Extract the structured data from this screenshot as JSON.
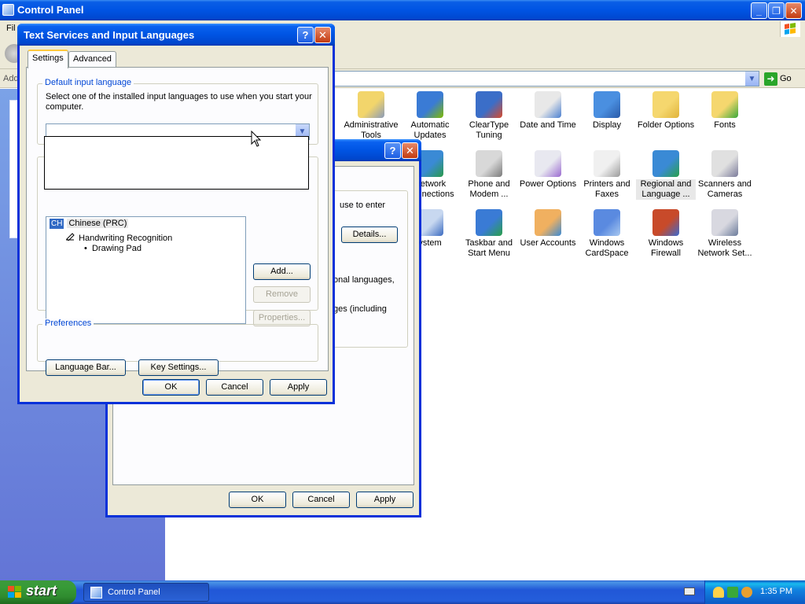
{
  "cp_window": {
    "title": "Control Panel",
    "menu_fragment": "Fil",
    "address_label_fragment": "Add",
    "go_label": "Go"
  },
  "cp_icons": [
    {
      "name": "administrative-tools",
      "label": "Administrative Tools",
      "icon": "folder-gear-icon"
    },
    {
      "name": "automatic-updates",
      "label": "Automatic Updates",
      "icon": "windows-globe-icon"
    },
    {
      "name": "cleartype-tuning",
      "label": "ClearType Tuning",
      "icon": "cleartype-icon"
    },
    {
      "name": "date-and-time",
      "label": "Date and Time",
      "icon": "clock-calendar-icon"
    },
    {
      "name": "display",
      "label": "Display",
      "icon": "monitor-icon"
    },
    {
      "name": "folder-options",
      "label": "Folder Options",
      "icon": "folder-icon"
    },
    {
      "name": "fonts",
      "label": "Fonts",
      "icon": "fonts-folder-icon"
    },
    {
      "name": "network-connections",
      "label": "Network Connections",
      "label_visible": "etwork\nnnections",
      "icon": "globe-network-icon"
    },
    {
      "name": "phone-and-modem",
      "label": "Phone and Modem ...",
      "icon": "phone-icon"
    },
    {
      "name": "power-options",
      "label": "Power Options",
      "icon": "power-icon"
    },
    {
      "name": "printers-and-faxes",
      "label": "Printers and Faxes",
      "icon": "printer-icon"
    },
    {
      "name": "regional-and-language",
      "label": "Regional and Language ...",
      "icon": "globe-icon"
    },
    {
      "name": "scanners-and-cameras",
      "label": "Scanners and Cameras",
      "icon": "scanner-camera-icon"
    },
    {
      "name": "system",
      "label": "ystem",
      "icon": "system-icon"
    },
    {
      "name": "taskbar-and-start-menu",
      "label": "Taskbar and Start Menu",
      "icon": "taskbar-icon"
    },
    {
      "name": "user-accounts",
      "label": "User Accounts",
      "icon": "users-icon"
    },
    {
      "name": "windows-cardspace",
      "label": "Windows CardSpace",
      "icon": "cardspace-icon"
    },
    {
      "name": "windows-firewall",
      "label": "Windows Firewall",
      "icon": "firewall-icon"
    },
    {
      "name": "wireless-network-setup",
      "label": "Wireless Network Set...",
      "icon": "wireless-icon"
    }
  ],
  "regional_dialog": {
    "text_use_to_enter": "use to enter",
    "details_button": "Details...",
    "text_languages": "onal languages,",
    "text_including": "ges (including",
    "ok": "OK",
    "cancel": "Cancel",
    "apply": "Apply"
  },
  "ts_dialog": {
    "title": "Text Services and Input Languages",
    "tabs": [
      "Settings",
      "Advanced"
    ],
    "default_lang_legend": "Default input language",
    "default_lang_desc_1": "Select one of the installed input languages to use when you start your",
    "default_lang_desc_2": "computer.",
    "combo_value": "",
    "installed": {
      "lang_code": "CH",
      "lang_name": "Chinese (PRC)",
      "service": "Handwriting Recognition",
      "subservice": "Drawing Pad"
    },
    "add_button": "Add...",
    "remove_button": "Remove",
    "properties_button": "Properties...",
    "preferences_legend": "Preferences",
    "language_bar_button": "Language Bar...",
    "key_settings_button": "Key Settings...",
    "ok": "OK",
    "cancel": "Cancel",
    "apply": "Apply"
  },
  "taskbar": {
    "start_label": "start",
    "task_label": "Control Panel",
    "clock": "1:35 PM"
  }
}
